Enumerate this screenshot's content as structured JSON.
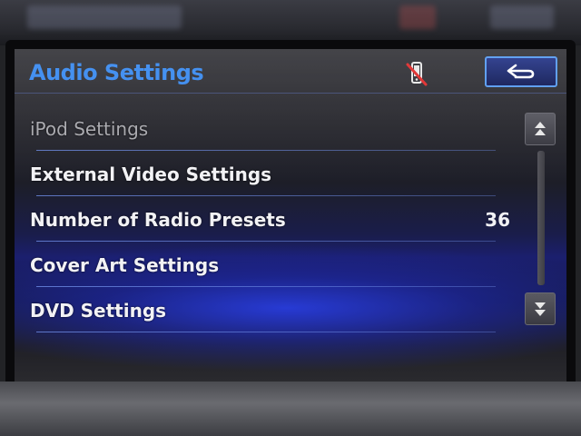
{
  "header": {
    "title": "Audio Settings",
    "phone_status_icon": "phone-disconnected-icon",
    "back_icon": "back-arrow-icon"
  },
  "list": {
    "items": [
      {
        "label": "iPod Settings",
        "value": "",
        "enabled": false
      },
      {
        "label": "External Video Settings",
        "value": "",
        "enabled": true
      },
      {
        "label": "Number of Radio Presets",
        "value": "36",
        "enabled": true
      },
      {
        "label": "Cover Art Settings",
        "value": "",
        "enabled": true
      },
      {
        "label": "DVD Settings",
        "value": "",
        "enabled": true
      }
    ]
  },
  "scrollbar": {
    "up_icon": "page-up-icon",
    "down_icon": "page-down-icon"
  },
  "colors": {
    "title": "#3d8cf0",
    "accent_blue": "#1b1f6e",
    "divider": "#6e8ce6",
    "phone_strike": "#e03030"
  }
}
